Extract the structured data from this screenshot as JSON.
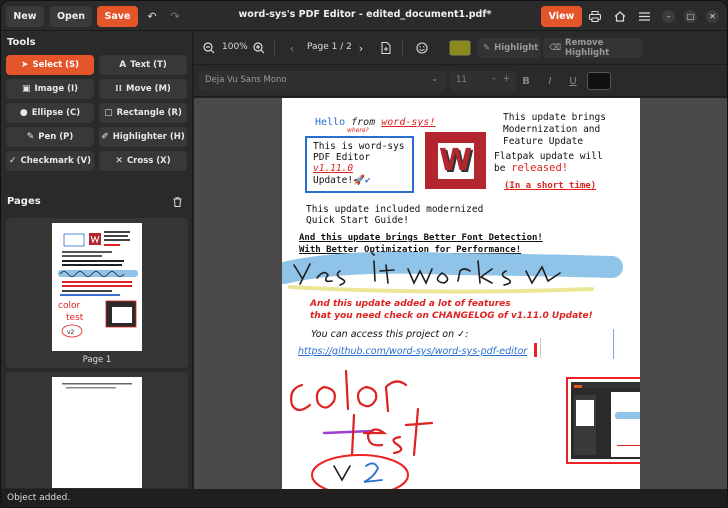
{
  "window": {
    "title": "word-sys's PDF Editor - edited_document1.pdf*"
  },
  "header": {
    "new_label": "New",
    "open_label": "Open",
    "save_label": "Save",
    "view_label": "View"
  },
  "sidebar": {
    "tools_title": "Tools",
    "tools": [
      {
        "label": "Select (S)",
        "icon": "cursor-icon"
      },
      {
        "label": "Text (T)",
        "icon": "text-icon"
      },
      {
        "label": "Image (I)",
        "icon": "image-icon"
      },
      {
        "label": "Move (M)",
        "icon": "move-icon"
      },
      {
        "label": "Ellipse (C)",
        "icon": "ellipse-icon"
      },
      {
        "label": "Rectangle (R)",
        "icon": "rectangle-icon"
      },
      {
        "label": "Pen (P)",
        "icon": "pen-icon"
      },
      {
        "label": "Highlighter (H)",
        "icon": "highlighter-icon"
      },
      {
        "label": "Checkmark (V)",
        "icon": "checkmark-icon"
      },
      {
        "label": "Cross (X)",
        "icon": "cross-icon"
      }
    ],
    "pages_title": "Pages",
    "page_label": "Page 1"
  },
  "toolbar": {
    "zoom": "100%",
    "page_indicator": "Page 1 / 2",
    "highlight_label": "Highlight",
    "remove_highlight_label": "Remove Highlight",
    "font_name": "Deja Vu Sans Mono",
    "font_size": "11",
    "highlight_color": "#8b8b1a"
  },
  "document": {
    "hello": "Hello",
    "from": "from",
    "word_sys": "word-sys!",
    "where": "where?",
    "box_line1": "This is word-sys",
    "box_line2": "PDF Editor",
    "box_version": "v1.11.0",
    "box_line4": "Update!",
    "update_brings_1": "This update brings",
    "update_brings_2": "Modernization and",
    "update_brings_3": "Feature Update",
    "flatpak_1": "Flatpak update will",
    "flatpak_be": "be",
    "flatpak_released": "released!",
    "short_time": "(In a short time)",
    "guide_1": "This update included modernized",
    "guide_2": "Quick Start Guide!",
    "font_detect_1": "And this update brings Better Font Detection!",
    "font_detect_2": "With Better Optimization for Performance!",
    "features_1": "And this update added a lot of features",
    "features_2": "that you need check on CHANGELOG of v1.11.0 Update!",
    "access": "You can access this project on ✓:",
    "link": "https://github.com/word-sys/word-sys-pdf-editor",
    "logo_letter": "W"
  },
  "status": {
    "text": "Object added."
  }
}
